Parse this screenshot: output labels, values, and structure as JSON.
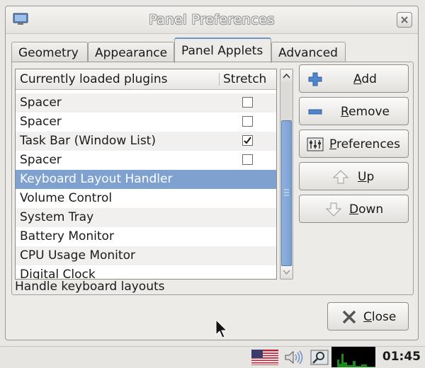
{
  "window": {
    "title": "Panel Preferences"
  },
  "tabs": [
    {
      "label": "Geometry",
      "active": false
    },
    {
      "label": "Appearance",
      "active": false
    },
    {
      "label": "Panel Applets",
      "active": true
    },
    {
      "label": "Advanced",
      "active": false
    }
  ],
  "plugins": {
    "columns": {
      "name": "Currently loaded plugins",
      "stretch": "Stretch"
    },
    "rows": [
      {
        "name": "Spacer",
        "stretch": false
      },
      {
        "name": "Spacer",
        "stretch": false
      },
      {
        "name": "Task Bar (Window List)",
        "stretch": true
      },
      {
        "name": "Spacer",
        "stretch": false
      },
      {
        "name": "Keyboard Layout Handler",
        "selected": true
      },
      {
        "name": "Volume Control"
      },
      {
        "name": "System Tray"
      },
      {
        "name": "Battery Monitor"
      },
      {
        "name": "CPU Usage Monitor"
      },
      {
        "name": "Digital Clock"
      }
    ],
    "description": "Handle keyboard layouts"
  },
  "buttons": {
    "add": "Add",
    "remove": "Remove",
    "preferences": "Preferences",
    "up": "Up",
    "down": "Down",
    "close": "Close"
  },
  "taskbar": {
    "clock": "01:45"
  },
  "colors": {
    "selection": "#7ea1d0",
    "accent": "#6e93c5"
  }
}
